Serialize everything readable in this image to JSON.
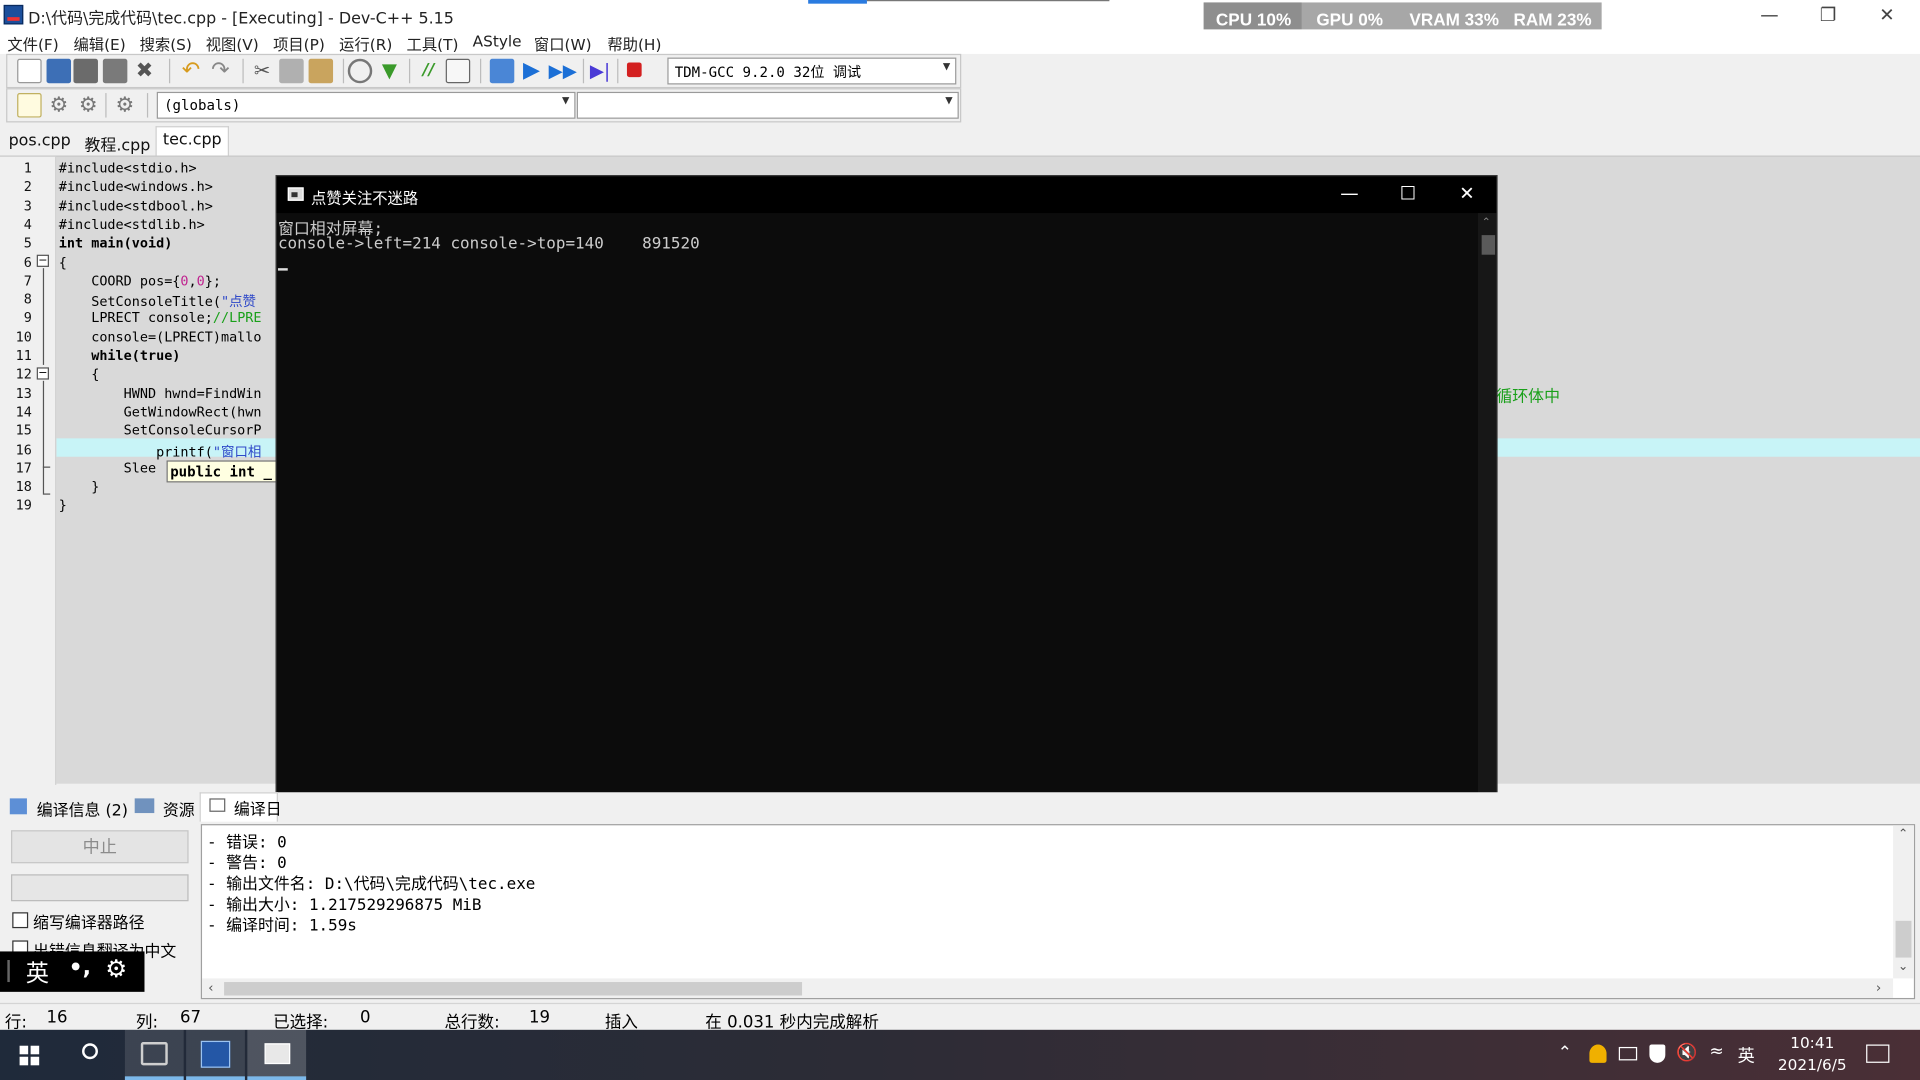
{
  "window": {
    "title": "D:\\代码\\完成代码\\tec.cpp - [Executing] - Dev-C++ 5.15"
  },
  "perf": {
    "cpu": "CPU 10%",
    "gpu": "GPU 0%",
    "vram": "VRAM 33%",
    "ram": "RAM 23%"
  },
  "menu": [
    "文件(F)",
    "编辑(E)",
    "搜索(S)",
    "视图(V)",
    "项目(P)",
    "运行(R)",
    "工具(T)",
    "AStyle",
    "窗口(W)",
    "帮助(H)"
  ],
  "toolbar": {
    "compiler": "TDM-GCC 9.2.0 32位 调试",
    "scope": "(globals)",
    "member": ""
  },
  "tabs": [
    "pos.cpp",
    "教程.cpp",
    "tec.cpp"
  ],
  "editor": {
    "line_numbers": [
      "1",
      "2",
      "3",
      "4",
      "5",
      "6",
      "7",
      "8",
      "9",
      "10",
      "11",
      "12",
      "13",
      "14",
      "15",
      "16",
      "17",
      "18",
      "19"
    ],
    "lines": [
      {
        "parts": [
          {
            "t": "#include<stdio.h>",
            "c": ""
          }
        ]
      },
      {
        "parts": [
          {
            "t": "#include<windows.h>",
            "c": ""
          }
        ]
      },
      {
        "parts": [
          {
            "t": "#include<stdbool.h>",
            "c": ""
          }
        ]
      },
      {
        "parts": [
          {
            "t": "#include<stdlib.h>",
            "c": ""
          }
        ]
      },
      {
        "parts": [
          {
            "t": "int main(void)",
            "c": "kw"
          }
        ]
      },
      {
        "parts": [
          {
            "t": "{",
            "c": ""
          }
        ]
      },
      {
        "parts": [
          {
            "t": "    COORD pos={",
            "c": ""
          },
          {
            "t": "0",
            "c": "num"
          },
          {
            "t": ",",
            "c": ""
          },
          {
            "t": "0",
            "c": "num"
          },
          {
            "t": "};",
            "c": ""
          }
        ]
      },
      {
        "parts": [
          {
            "t": "    SetConsoleTitle(",
            "c": ""
          },
          {
            "t": "\"点赞",
            "c": "str"
          }
        ]
      },
      {
        "parts": [
          {
            "t": "    LPRECT console;",
            "c": ""
          },
          {
            "t": "//LPRE",
            "c": "cmt"
          }
        ]
      },
      {
        "parts": [
          {
            "t": "    console=(LPRECT)mallo",
            "c": ""
          }
        ]
      },
      {
        "parts": [
          {
            "t": "    while(true)",
            "c": "kw"
          }
        ]
      },
      {
        "parts": [
          {
            "t": "    {",
            "c": ""
          }
        ]
      },
      {
        "parts": [
          {
            "t": "        HWND hwnd=FindWin",
            "c": ""
          }
        ]
      },
      {
        "parts": [
          {
            "t": "        GetWindowRect(hwn",
            "c": ""
          }
        ]
      },
      {
        "parts": [
          {
            "t": "        SetConsoleCursorP",
            "c": ""
          }
        ]
      },
      {
        "parts": [
          {
            "t": "            printf(",
            "c": ""
          },
          {
            "t": "\"窗口相",
            "c": "str"
          }
        ]
      },
      {
        "parts": [
          {
            "t": "        Slee",
            "c": ""
          }
        ]
      },
      {
        "parts": [
          {
            "t": "    }",
            "c": ""
          }
        ]
      },
      {
        "parts": [
          {
            "t": "}",
            "c": ""
          }
        ]
      }
    ],
    "tooltip": "public int _",
    "side_comment": "循环体中"
  },
  "console": {
    "title": "点赞关注不迷路",
    "lines": [
      "窗口相对屏幕;",
      "console->left=214 console->top=140    891520"
    ]
  },
  "bottom_tabs": [
    "编译信息 (2)",
    "资源",
    "编译日"
  ],
  "left_panel": {
    "stop": "中止",
    "check1": "缩写编译器路径",
    "check2": "出错信息翻译为中文"
  },
  "log": [
    "- 错误: 0",
    "- 警告: 0",
    "- 输出文件名: D:\\代码\\完成代码\\tec.exe",
    "- 输出大小: 1.217529296875 MiB",
    "- 编译时间: 1.59s"
  ],
  "ime": {
    "lang": "英",
    "punct": "•,"
  },
  "status": {
    "row_label": "行:",
    "row": "16",
    "col_label": "列:",
    "col": "67",
    "sel_label": "已选择:",
    "sel": "0",
    "total_label": "总行数:",
    "total": "19",
    "mode": "插入",
    "parse": "在 0.031 秒内完成解析"
  },
  "taskbar": {
    "ime": "英",
    "time": "10:41",
    "date": "2021/6/5"
  }
}
